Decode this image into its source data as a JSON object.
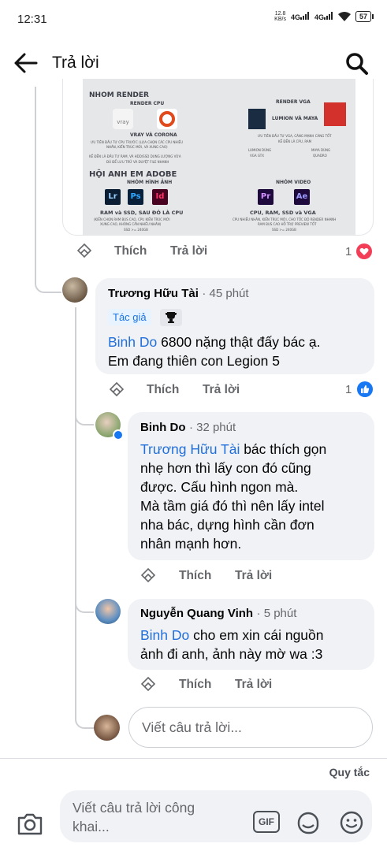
{
  "status_bar": {
    "time": "12:31",
    "net_speed_top": "12.8",
    "net_speed_bottom": "KB/s",
    "signal1": "4G",
    "signal2": "4G",
    "battery": "57"
  },
  "header": {
    "title": "Trả lời",
    "back_icon": "arrow-left-icon",
    "search_icon": "search-icon"
  },
  "image_text": {
    "render_heading": "NHOM RENDER",
    "render_cpu": "RENDER CPU",
    "render_vga": "RENDER VGA",
    "vray_corona": "VRAY VÀ CORONA",
    "lumion_maya": "LUMION VÀ MAYA",
    "cpu_note1": "ƯU TIÊN ĐẦU TƯ CPU TRƯỚC (LỰA CHỌN CÁC CPU NHIỀU",
    "cpu_note2": "NHÂN, KIẾN TRÚC MỚI, VÀ XUNG CAO)",
    "ram_note1": "KẾ ĐẾN LÀ ĐẦU TƯ RAM, VÀ HDD/SSD DUNG LƯỢNG VỪA",
    "ram_note2": "ĐỦ ĐỂ LƯU TRỮ VÀ DUYỆT FILE NHANH",
    "vga_note1": "ƯU TIÊN ĐẦU TƯ VGA, CÀNG MẠNH CÀNG TỐT",
    "vga_note2": "KẾ ĐẾN LÀ CPU, RAM",
    "lumion_dung": "LUMION DÙNG",
    "vga_gtx": "VGA GTX",
    "maya_dung": "MAYA DÙNG",
    "quadro": "QUADRO",
    "adobe_heading": "HỘI ANH EM ADOBE",
    "nhom_hinh_anh": "NHÓM HÌNH ẢNH",
    "nhom_video": "NHÓM VIDEO",
    "ram_ssd_cpu": "RAM và SSD, SAU ĐÓ LÀ CPU",
    "cpu_ram_ssd_vga": "CPU, RAM, SSD và VGA",
    "adobe_note1": "(KIẾN CHỌN RAM BUS CAO, CPU KIẾN TRÚC MỚI",
    "adobe_note2": "XUNG CAO, KHÔNG CẦN NHIỀU NHÂN)",
    "video_note1": "CPU NHIỀU NHÂN, KIẾN TRÚC MỚI, CHO TỐC ĐỘ RENDER NHANH",
    "video_note2": "RAM BUS CAO HỖ TRỢ PREVIEW TỐT",
    "ssd_note": "SSD >= 240GB",
    "ssd_note2": "SSD >= 240GB",
    "apps": [
      "Lr",
      "Ps",
      "Id",
      "Pr",
      "Ae"
    ]
  },
  "image_actions": {
    "like": "Thích",
    "reply": "Trả lời",
    "reaction_count": "1",
    "reaction_icon": "love-heart-icon"
  },
  "comments": [
    {
      "name": "Trương Hữu Tài",
      "time": "· 45 phút",
      "author_badge": "Tác giả",
      "trophy_icon": "trophy-icon",
      "mention": "Binh Do",
      "text_line1": " 6800 nặng thật đấy bác ạ.",
      "text_line2": "Em đang thiên con Legion 5",
      "like": "Thích",
      "reply": "Trả lời",
      "reaction_count": "1",
      "reaction_icon": "like-thumb-icon"
    },
    {
      "name": "Binh Do",
      "time": "· 32 phút",
      "mention": "Trương Hữu Tài",
      "lines": [
        " bác thích gọn",
        "nhẹ hơn thì lấy con đó cũng",
        "được. Cấu hình ngon mà.",
        "Mà tầm giá đó thì nên lấy intel",
        "nha bác, dựng hình cần đơn",
        "nhân mạnh hơn."
      ],
      "like": "Thích",
      "reply": "Trả lời"
    },
    {
      "name": "Nguyễn Quang Vinh",
      "time": "· 5 phút",
      "mention": "Binh Do",
      "text_line1": " cho em xin cái nguồn",
      "text_line2": "ảnh đi anh, ảnh này mờ wa :3",
      "like": "Thích",
      "reply": "Trả lời"
    }
  ],
  "reply_input": {
    "placeholder": "Viết câu trả lời..."
  },
  "footer": {
    "rules": "Quy tắc",
    "placeholder_line1": "Viết câu trả lời công",
    "placeholder_line2": "khai...",
    "gif_label": "GIF",
    "camera_icon": "camera-icon",
    "sticker_icon": "sticker-icon",
    "emoji_icon": "emoji-icon"
  },
  "colors": {
    "mention": "#216fdb",
    "bubble": "#f0f2f5",
    "muted": "#65676b",
    "love": "#f33e58",
    "like": "#1877f2"
  }
}
